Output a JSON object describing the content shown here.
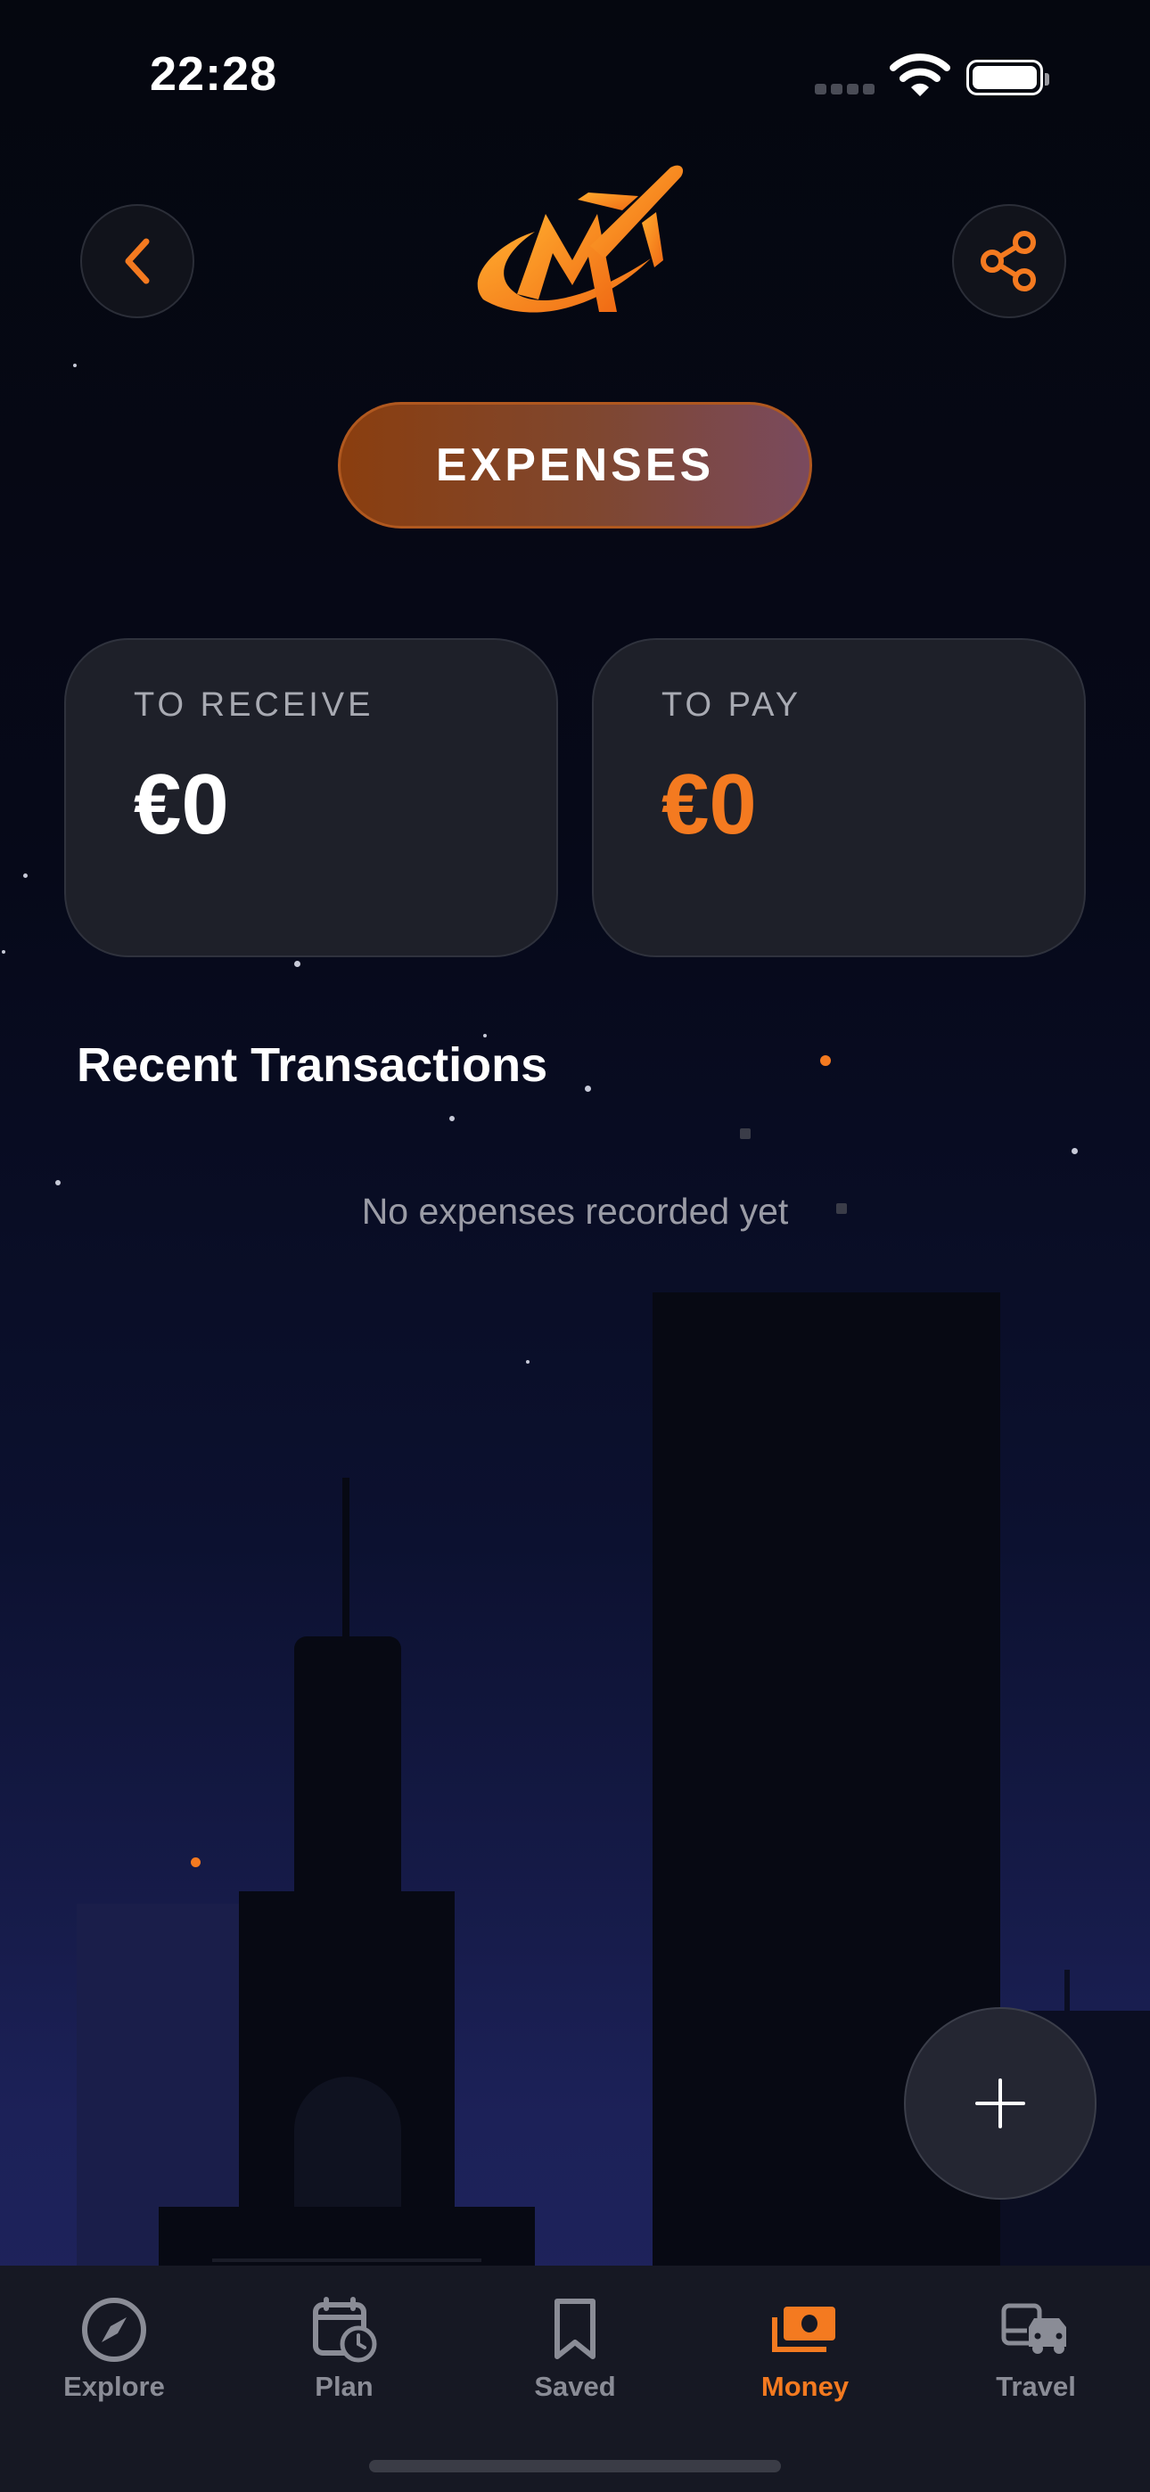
{
  "status_bar": {
    "time": "22:28"
  },
  "header": {
    "section_label": "EXPENSES"
  },
  "balances": {
    "to_receive": {
      "label": "TO RECEIVE",
      "value": "€0"
    },
    "to_pay": {
      "label": "TO PAY",
      "value": "€0"
    }
  },
  "transactions": {
    "title": "Recent Transactions",
    "empty_message": "No expenses recorded yet"
  },
  "tabs": [
    {
      "label": "Explore",
      "icon": "compass-icon",
      "active": false
    },
    {
      "label": "Plan",
      "icon": "calendar-clock-icon",
      "active": false
    },
    {
      "label": "Saved",
      "icon": "bookmark-icon",
      "active": false
    },
    {
      "label": "Money",
      "icon": "money-icon",
      "active": true
    },
    {
      "label": "Travel",
      "icon": "bus-car-icon",
      "active": false
    }
  ],
  "colors": {
    "accent": "#f47a20",
    "background": "#05070f",
    "card": "#1e2029",
    "inactive_tab": "#8a8c96"
  }
}
